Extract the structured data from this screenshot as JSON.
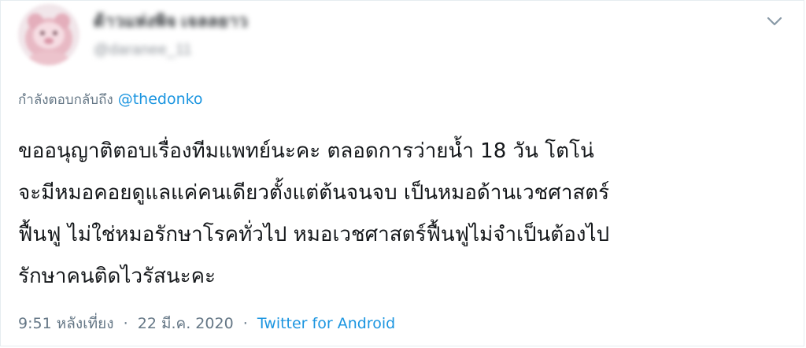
{
  "author": {
    "display_name": "ด้าวแห่งพิจ เจลลยาว",
    "handle": "@daranee_11"
  },
  "reply": {
    "prefix": "กำลังตอบกลับถึง",
    "mention": "@thedonko"
  },
  "tweet": {
    "lines": [
      "ขออนุญาติตอบเรื่องทีมแพทย์นะคะ ตลอดการว่ายน้ำ 18 วัน โตโน่",
      "จะมีหมอคอยดูแลแค่คนเดียวตั้งแต่ต้นจนจบ เป็นหมอด้านเวชศาสตร์",
      "ฟื้นฟู ไม่ใช่หมอรักษาโรคทั่วไป หมอเวชศาสตร์ฟื้นฟูไม่จำเป็นต้องไป",
      "รักษาคนติดไวรัสนะคะ"
    ]
  },
  "meta": {
    "time": "9:51 หลังเที่ยง",
    "separator": "·",
    "date": "22 มี.ค. 2020",
    "source": "Twitter for Android"
  },
  "icons": {
    "menu": "chevron-down-icon",
    "avatar": "avatar"
  },
  "colors": {
    "link": "#1b95e0",
    "secondary_text": "#657786",
    "primary_text": "#14171a",
    "border": "#e6ecf0"
  }
}
